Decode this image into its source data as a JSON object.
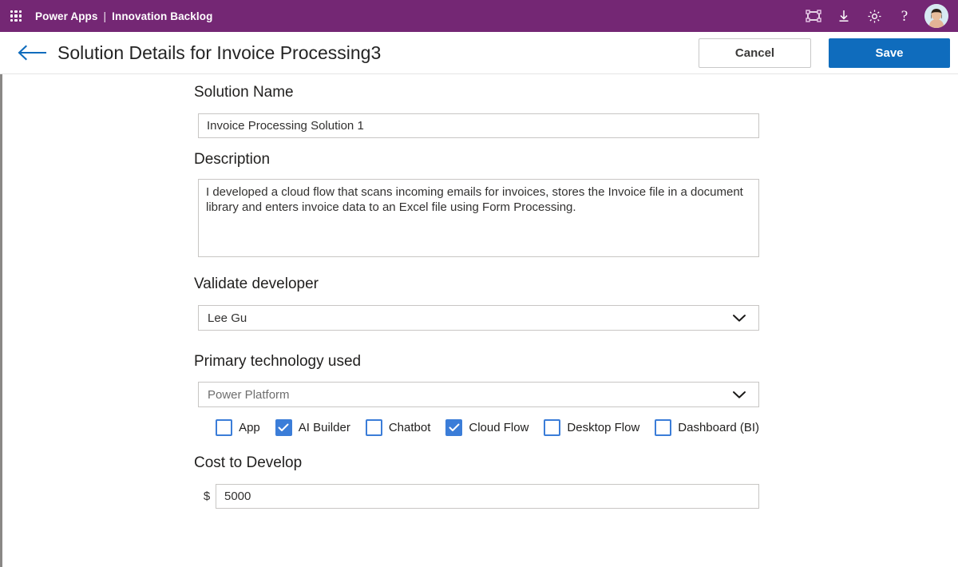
{
  "suite": {
    "waffle_icon": "app-launcher-icon",
    "app_name": "Power Apps",
    "separator": "|",
    "environment_name": "Innovation Backlog",
    "actions": [
      {
        "name": "environment-frame-icon",
        "label": "Environment"
      },
      {
        "name": "download-icon",
        "label": "Download"
      },
      {
        "name": "gear-icon",
        "label": "Settings"
      },
      {
        "name": "help-icon",
        "label": "?"
      }
    ],
    "avatar_label": "Account manager"
  },
  "title_bar": {
    "back_icon": "back-arrow-icon",
    "title": "Solution Details for Invoice Processing3",
    "cancel_label": "Cancel",
    "save_label": "Save"
  },
  "form": {
    "solution_name": {
      "label": "Solution Name",
      "value": "Invoice Processing Solution 1",
      "placeholder": ""
    },
    "description": {
      "label": "Description",
      "value": "I developed a cloud flow that scans incoming emails for invoices, stores the Invoice file in a document library and enters invoice data to an Excel file using Form Processing.",
      "placeholder": ""
    },
    "validate_developer": {
      "label": "Validate developer",
      "value": "Lee Gu",
      "chevron_icon": "chevron-down-icon"
    },
    "primary_technology": {
      "label": "Primary technology used",
      "value": "Power Platform",
      "chevron_icon": "chevron-down-icon"
    },
    "technology_options": [
      {
        "label": "App",
        "checked": false
      },
      {
        "label": "AI Builder",
        "checked": true
      },
      {
        "label": "Chatbot",
        "checked": false
      },
      {
        "label": "Cloud Flow",
        "checked": true
      },
      {
        "label": "Desktop Flow",
        "checked": false
      },
      {
        "label": "Dashboard (BI)",
        "checked": false
      }
    ],
    "cost_to_develop": {
      "label": "Cost to Develop",
      "currency_symbol": "$",
      "value": "5000",
      "placeholder": ""
    }
  },
  "colors": {
    "suite_bar": "#742774",
    "primary_blue": "#0f6cbd",
    "checkbox_blue": "#3b7dd8",
    "border_gray": "#c8c6c4",
    "text_dark": "#201f1e"
  }
}
